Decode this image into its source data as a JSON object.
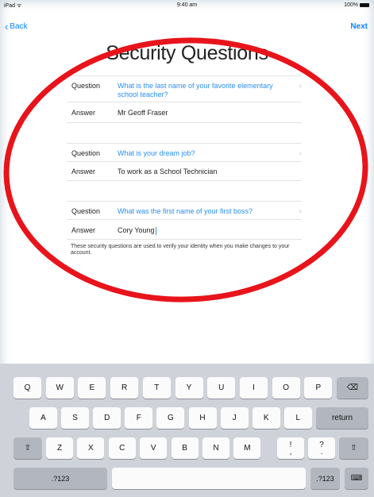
{
  "status": {
    "left": "iPad ᯤ",
    "time": "9:40 am",
    "battery": "100%"
  },
  "nav": {
    "back": "Back",
    "next": "Next"
  },
  "page_title": "Security Questions",
  "form": {
    "question_label": "Question",
    "answer_label": "Answer",
    "blocks": [
      {
        "question": "What is the last name of your favorite elementary school teacher?",
        "answer": "Mr Geoff Fraser"
      },
      {
        "question": "What is your dream job?",
        "answer": "To work as a School Technician"
      },
      {
        "question": "What was the first name of your first boss?",
        "answer": "Cory Young"
      }
    ],
    "chevron": "›",
    "note": "These security questions are used to verify your identity when you make changes to your account."
  },
  "annotation_color": "#e8141b",
  "keyboard": {
    "row1": [
      "Q",
      "W",
      "E",
      "R",
      "T",
      "Y",
      "U",
      "I",
      "O",
      "P"
    ],
    "row2": [
      "A",
      "S",
      "D",
      "F",
      "G",
      "H",
      "J",
      "K",
      "L"
    ],
    "row3": [
      "Z",
      "X",
      "C",
      "V",
      "B",
      "N",
      "M"
    ],
    "exclaim": {
      "top": "!",
      "bottom": ","
    },
    "question": {
      "top": "?",
      "bottom": "."
    },
    "return_label": "return",
    "numbers_label": ".?123",
    "backspace_icon": "⌫",
    "shift_icon": "⇧",
    "hide_keyboard_icon": "⌨"
  }
}
